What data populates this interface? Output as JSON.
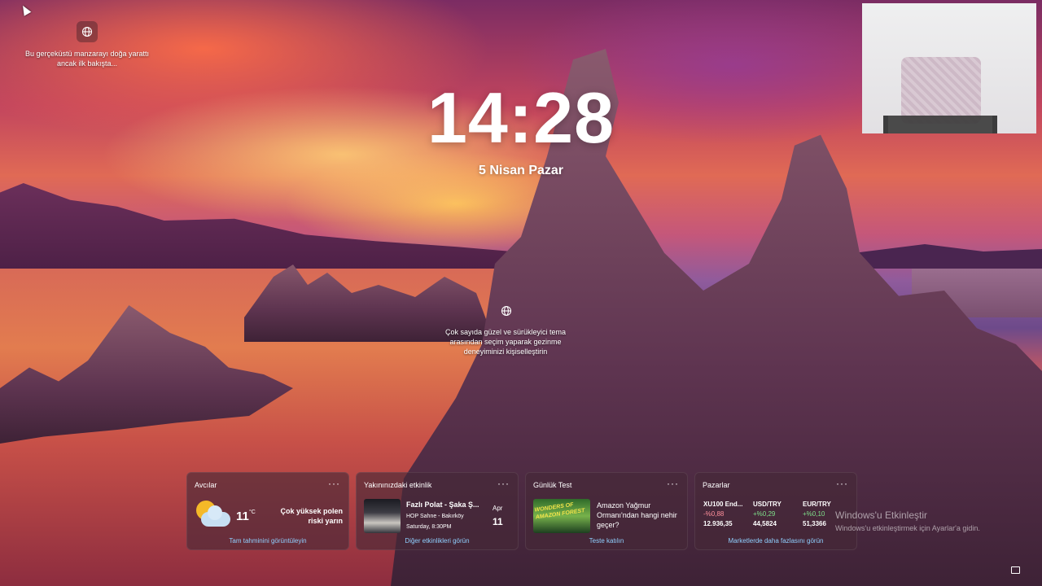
{
  "spotlight": {
    "top_left_text": "Bu gerçeküstü manzarayı doğa yarattı ancak ilk bakışta...",
    "center_text": "Çok sayıda güzel ve sürükleyici tema arasından seçim yaparak gezinme deneyiminizi kişiselleştirin"
  },
  "lock": {
    "time": "14:28",
    "date": "5 Nisan Pazar"
  },
  "widgets": {
    "more": "···",
    "weather": {
      "title": "Avcılar",
      "temp": "11",
      "unit": "°C",
      "desc": "Çok yüksek polen riski yarın",
      "link": "Tam tahminini görüntüleyin"
    },
    "event": {
      "title": "Yakınınızdaki etkinlik",
      "name": "Fazlı Polat - Şaka Ş...",
      "venue": "HOP Sahne - Bakırköy",
      "time": "Saturday, 8:30PM",
      "month": "Apr",
      "day": "11",
      "link": "Diğer etkinlikleri görün"
    },
    "quiz": {
      "title": "Günlük Test",
      "thumb_label": "WONDERS OF AMAZON FOREST",
      "question": "Amazon Yağmur Ormanı'ndan hangi nehir geçer?",
      "link": "Teste katılın"
    },
    "markets": {
      "title": "Pazarlar",
      "items": [
        {
          "name": "XU100 End...",
          "change": "-%0,88",
          "value": "12.936,35",
          "color": "#ff8f9a"
        },
        {
          "name": "USD/TRY",
          "change": "+%0,29",
          "value": "44,5824",
          "color": "#7fe08a"
        },
        {
          "name": "EUR/TRY",
          "change": "+%0,10",
          "value": "51,3366",
          "color": "#7fe08a"
        }
      ],
      "link": "Marketlerde daha fazlasını görün"
    }
  },
  "watermark": {
    "title": "Windows'u Etkinleştir",
    "subtitle": "Windows'u etkinleştirmek için Ayarlar'a gidin."
  }
}
